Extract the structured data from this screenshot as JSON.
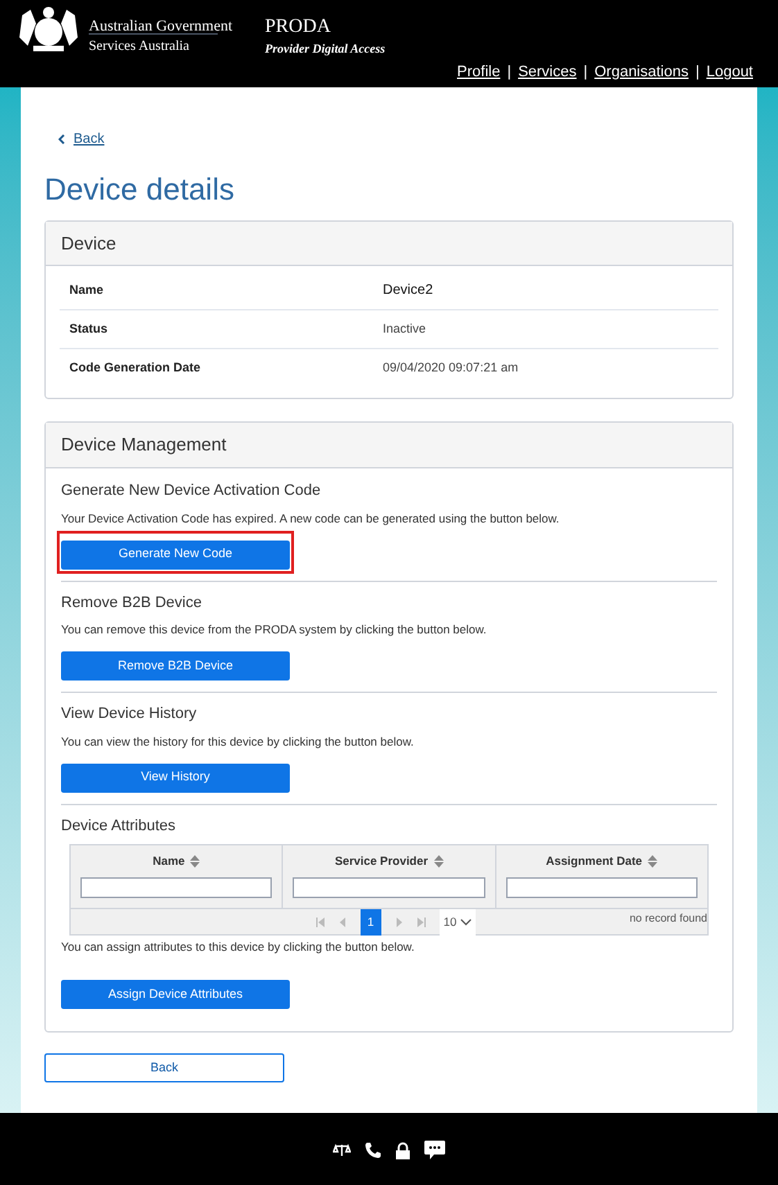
{
  "header": {
    "agency": "Australian Government",
    "department": "Services Australia",
    "app_name": "PRODA",
    "app_subtitle": "Provider Digital Access",
    "nav": [
      "Profile",
      "Services",
      "Organisations",
      "Logout"
    ],
    "separator": "|"
  },
  "back_link": "Back",
  "title": "Device details",
  "device_panel": {
    "title": "Device",
    "rows": [
      {
        "label": "Name",
        "value": "Device2"
      },
      {
        "label": "Status",
        "value": "Inactive"
      },
      {
        "label": "Code Generation Date",
        "value": "09/04/2020 09:07:21 am"
      }
    ]
  },
  "management_panel": {
    "title": "Device Management",
    "sections": [
      {
        "kind": "action",
        "title": "Generate New Device Activation Code",
        "text": "Your Device Activation Code has expired. A new code can be generated using the button below.",
        "button": "Generate New Code",
        "highlighted": true
      },
      {
        "kind": "action",
        "title": "Remove B2B Device",
        "text": "You can remove this device from the PRODA system by clicking the button below.",
        "button": "Remove B2B Device",
        "highlighted": false
      },
      {
        "kind": "action",
        "title": "View Device History",
        "text": "You can view the history for this device by clicking the button below.",
        "button": "View History",
        "highlighted": false
      },
      {
        "kind": "table",
        "title": "Device Attributes",
        "columns": [
          "Name",
          "Service Provider",
          "Assignment Date"
        ],
        "pager": {
          "pages": [
            {
              "label": "1",
              "selected": true
            }
          ],
          "page_size": "10",
          "empty_text": "no record found"
        },
        "text": "You can assign attributes to this device by clicking the button below.",
        "button": "Assign Device Attributes"
      }
    ]
  },
  "back_button": "Back"
}
